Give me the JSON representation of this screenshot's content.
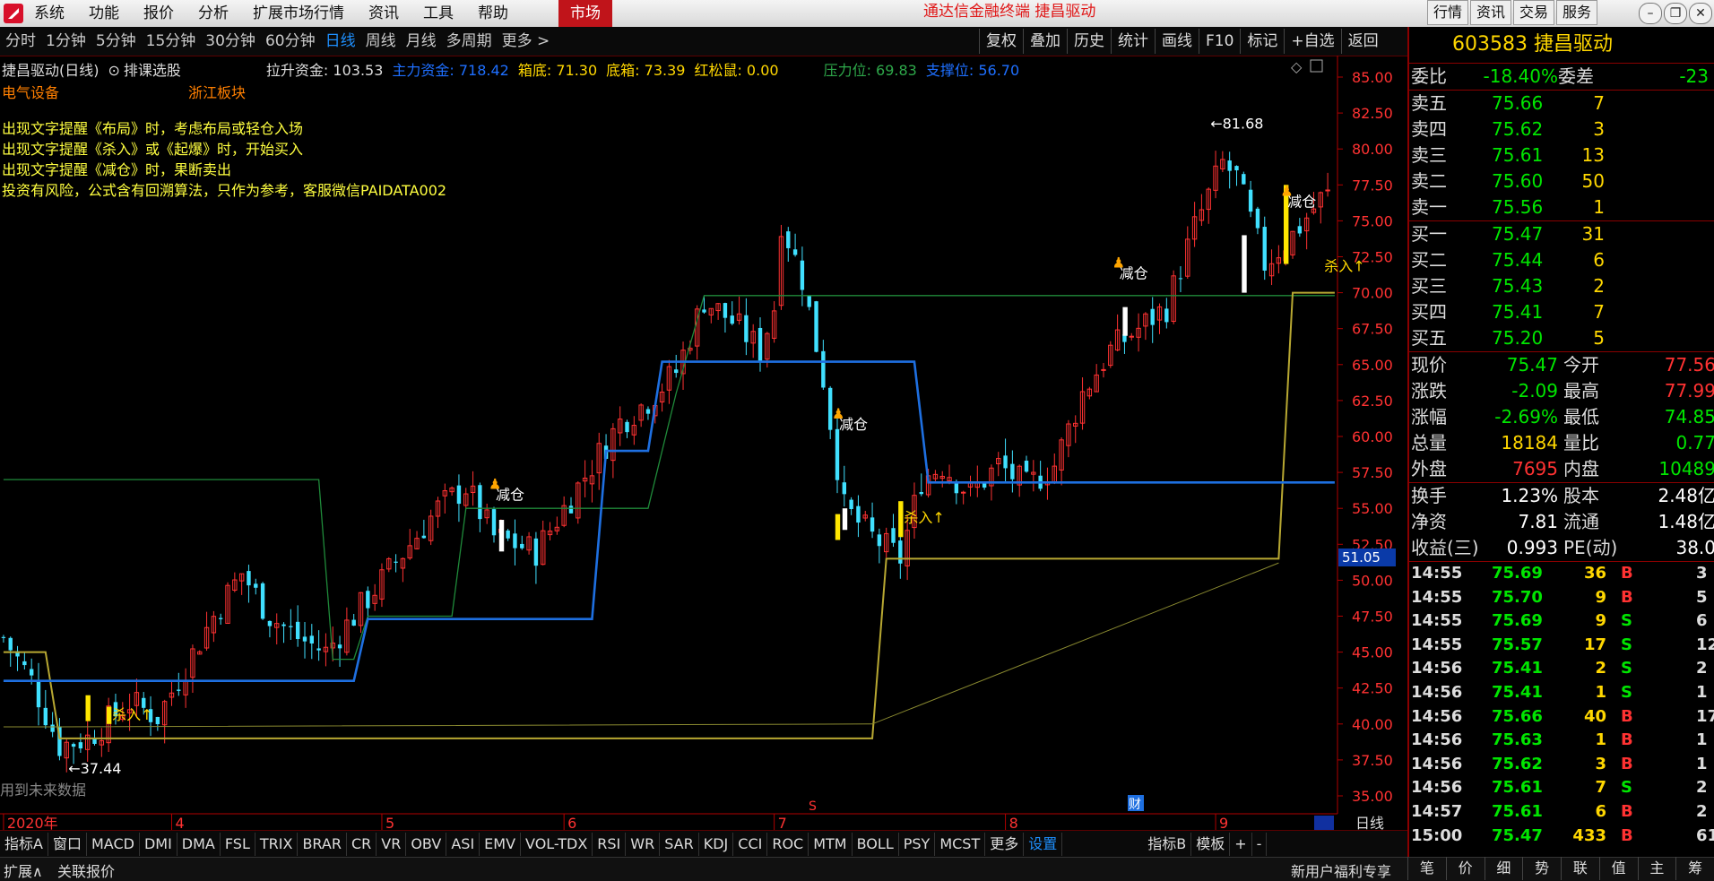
{
  "app": {
    "menu": [
      "系统",
      "功能",
      "报价",
      "分析",
      "扩展市场行情",
      "资讯",
      "工具",
      "帮助"
    ],
    "market_button": "市场",
    "title": "通达信金融终端  捷昌驱动",
    "right_tabs": [
      "行情",
      "资讯",
      "交易",
      "服务"
    ]
  },
  "toolbar": {
    "periods": [
      "分时",
      "1分钟",
      "5分钟",
      "15分钟",
      "30分钟",
      "60分钟",
      "日线",
      "周线",
      "月线",
      "多周期",
      "更多 >"
    ],
    "active_period": "日线",
    "tools": [
      "复权",
      "叠加",
      "历史",
      "统计",
      "画线",
      "F10",
      "标记",
      "+自选",
      "返回"
    ]
  },
  "info": {
    "name": "捷昌驱动(日线)",
    "select": "排课选股",
    "fund_label": "拉升资金: 103.53",
    "main_fund": "主力资金: 718.42",
    "box_bottom": "箱底: 71.30",
    "box_base": "底箱: 73.39",
    "red_mouse": "红松鼠: 0.00",
    "pressure": "压力位: 69.83",
    "support": "支撑位: 56.70",
    "sector1": "电气设备",
    "sector2": "浙江板块",
    "tips": [
      "出现文字提醒《布局》时，考虑布局或轻仓入场",
      "出现文字提醒《杀入》或《起爆》时，开始买入",
      "出现文字提醒《减仓》时，果断卖出",
      "投资有风险，公式含有回溯算法，只作为参考，客服微信PAIDATA002"
    ],
    "future_note": "用到未来数据",
    "price_tag": "51.05",
    "max_label": "81.68",
    "min_label": "37.44",
    "sell_signal": "减仓",
    "buy_signal": "杀入↑",
    "cai": "财",
    "s_mark": "S"
  },
  "chart_data": {
    "type": "candlestick",
    "title": "捷昌驱动(日线)",
    "y_ticks": [
      35.0,
      37.5,
      40.0,
      42.5,
      45.0,
      47.5,
      50.0,
      52.5,
      55.0,
      57.5,
      60.0,
      62.5,
      65.0,
      67.5,
      70.0,
      72.5,
      75.0,
      77.5,
      80.0,
      82.5,
      85.0
    ],
    "x_ticks": [
      "2020年",
      "4",
      "5",
      "6",
      "7",
      "8",
      "9"
    ],
    "x_tick_index": [
      0,
      24,
      54,
      80,
      110,
      143,
      173
    ],
    "period_label": "日线",
    "blue_line": [
      [
        0,
        43
      ],
      [
        2,
        43
      ],
      [
        50,
        43
      ],
      [
        52,
        47.3
      ],
      [
        84,
        47.3
      ],
      [
        86,
        59
      ],
      [
        92,
        59
      ],
      [
        94,
        65.2
      ],
      [
        130,
        65.2
      ],
      [
        132,
        56.8
      ],
      [
        190,
        56.8
      ]
    ],
    "gold_line": [
      [
        0,
        45
      ],
      [
        6,
        45
      ],
      [
        8,
        39
      ],
      [
        124,
        39
      ],
      [
        126,
        51.5
      ],
      [
        182,
        51.5
      ],
      [
        184,
        70
      ],
      [
        190,
        70
      ]
    ],
    "green_line": [
      [
        0,
        57
      ],
      [
        45,
        57
      ],
      [
        47,
        44.5
      ],
      [
        50,
        44.5
      ],
      [
        52,
        47.5
      ],
      [
        64,
        47.5
      ],
      [
        66,
        55
      ],
      [
        92,
        55
      ],
      [
        96,
        63
      ],
      [
        100,
        69.8
      ],
      [
        190,
        69.8
      ]
    ],
    "signals_sell": [
      [
        70,
        55.6
      ],
      [
        119,
        60.5
      ],
      [
        159,
        71
      ],
      [
        183,
        76
      ]
    ],
    "signals_buy": [
      [
        15,
        40.3
      ],
      [
        128,
        54
      ],
      [
        188,
        71.5
      ]
    ]
  },
  "bottom_tabs": [
    "指标A",
    "窗口",
    "MACD",
    "DMI",
    "DMA",
    "FSL",
    "TRIX",
    "BRAR",
    "CR",
    "VR",
    "OBV",
    "ASI",
    "EMV",
    "VOL-TDX",
    "RSI",
    "WR",
    "SAR",
    "KDJ",
    "CCI",
    "ROC",
    "MTM",
    "BOLL",
    "PSY",
    "MCST",
    "更多",
    "设置",
    "指标B",
    "模板",
    "+",
    "-"
  ],
  "status": {
    "left1": "扩展∧",
    "left2": "关联报价",
    "right": "新用户福利专享"
  },
  "panel": {
    "code_name": "603583 捷昌驱动",
    "weibi": {
      "label": "委比",
      "value": "-18.40%",
      "label2": "委差",
      "value2": "-23"
    },
    "sells": [
      {
        "label": "卖五",
        "price": "75.66",
        "vol": "7"
      },
      {
        "label": "卖四",
        "price": "75.62",
        "vol": "3"
      },
      {
        "label": "卖三",
        "price": "75.61",
        "vol": "13"
      },
      {
        "label": "卖二",
        "price": "75.60",
        "vol": "50"
      },
      {
        "label": "卖一",
        "price": "75.56",
        "vol": "1"
      }
    ],
    "buys": [
      {
        "label": "买一",
        "price": "75.47",
        "vol": "31"
      },
      {
        "label": "买二",
        "price": "75.44",
        "vol": "6"
      },
      {
        "label": "买三",
        "price": "75.43",
        "vol": "2"
      },
      {
        "label": "买四",
        "price": "75.41",
        "vol": "7"
      },
      {
        "label": "买五",
        "price": "75.20",
        "vol": "5"
      }
    ],
    "stats": [
      {
        "l1": "现价",
        "v1": "75.47",
        "l2": "今开",
        "v2": "77.56",
        "c1": "green",
        "c2": "red"
      },
      {
        "l1": "涨跌",
        "v1": "-2.09",
        "l2": "最高",
        "v2": "77.99",
        "c1": "green",
        "c2": "red"
      },
      {
        "l1": "涨幅",
        "v1": "-2.69%",
        "l2": "最低",
        "v2": "74.85",
        "c1": "green",
        "c2": "green"
      },
      {
        "l1": "总量",
        "v1": "18184",
        "l2": "量比",
        "v2": "0.77",
        "c1": "yellow",
        "c2": "green"
      },
      {
        "l1": "外盘",
        "v1": "7695",
        "l2": "内盘",
        "v2": "10489",
        "c1": "red",
        "c2": "green"
      }
    ],
    "stats2": [
      {
        "l1": "换手",
        "v1": "1.23%",
        "l2": "股本",
        "v2": "2.48亿"
      },
      {
        "l1": "净资",
        "v1": "7.81",
        "l2": "流通",
        "v2": "1.48亿"
      },
      {
        "l1": "收益(三)",
        "v1": "0.993",
        "l2": "PE(动)",
        "v2": "38.0"
      }
    ],
    "ticks": [
      {
        "t": "14:55",
        "p": "75.69",
        "v": "36",
        "d": "B",
        "x": "3"
      },
      {
        "t": "14:55",
        "p": "75.70",
        "v": "9",
        "d": "B",
        "x": "5"
      },
      {
        "t": "14:55",
        "p": "75.69",
        "v": "9",
        "d": "S",
        "x": "6"
      },
      {
        "t": "14:55",
        "p": "75.57",
        "v": "17",
        "d": "S",
        "x": "12"
      },
      {
        "t": "14:56",
        "p": "75.41",
        "v": "2",
        "d": "S",
        "x": "2"
      },
      {
        "t": "14:56",
        "p": "75.41",
        "v": "1",
        "d": "S",
        "x": "1"
      },
      {
        "t": "14:56",
        "p": "75.66",
        "v": "40",
        "d": "B",
        "x": "17"
      },
      {
        "t": "14:56",
        "p": "75.63",
        "v": "1",
        "d": "B",
        "x": "1"
      },
      {
        "t": "14:56",
        "p": "75.62",
        "v": "3",
        "d": "B",
        "x": "1"
      },
      {
        "t": "14:56",
        "p": "75.61",
        "v": "7",
        "d": "S",
        "x": "2"
      },
      {
        "t": "14:57",
        "p": "75.61",
        "v": "6",
        "d": "B",
        "x": "2"
      },
      {
        "t": "15:00",
        "p": "75.47",
        "v": "433",
        "d": "B",
        "x": "61"
      }
    ],
    "bottom_tabs": [
      "笔",
      "价",
      "细",
      "势",
      "联",
      "值",
      "主",
      "筹"
    ]
  }
}
